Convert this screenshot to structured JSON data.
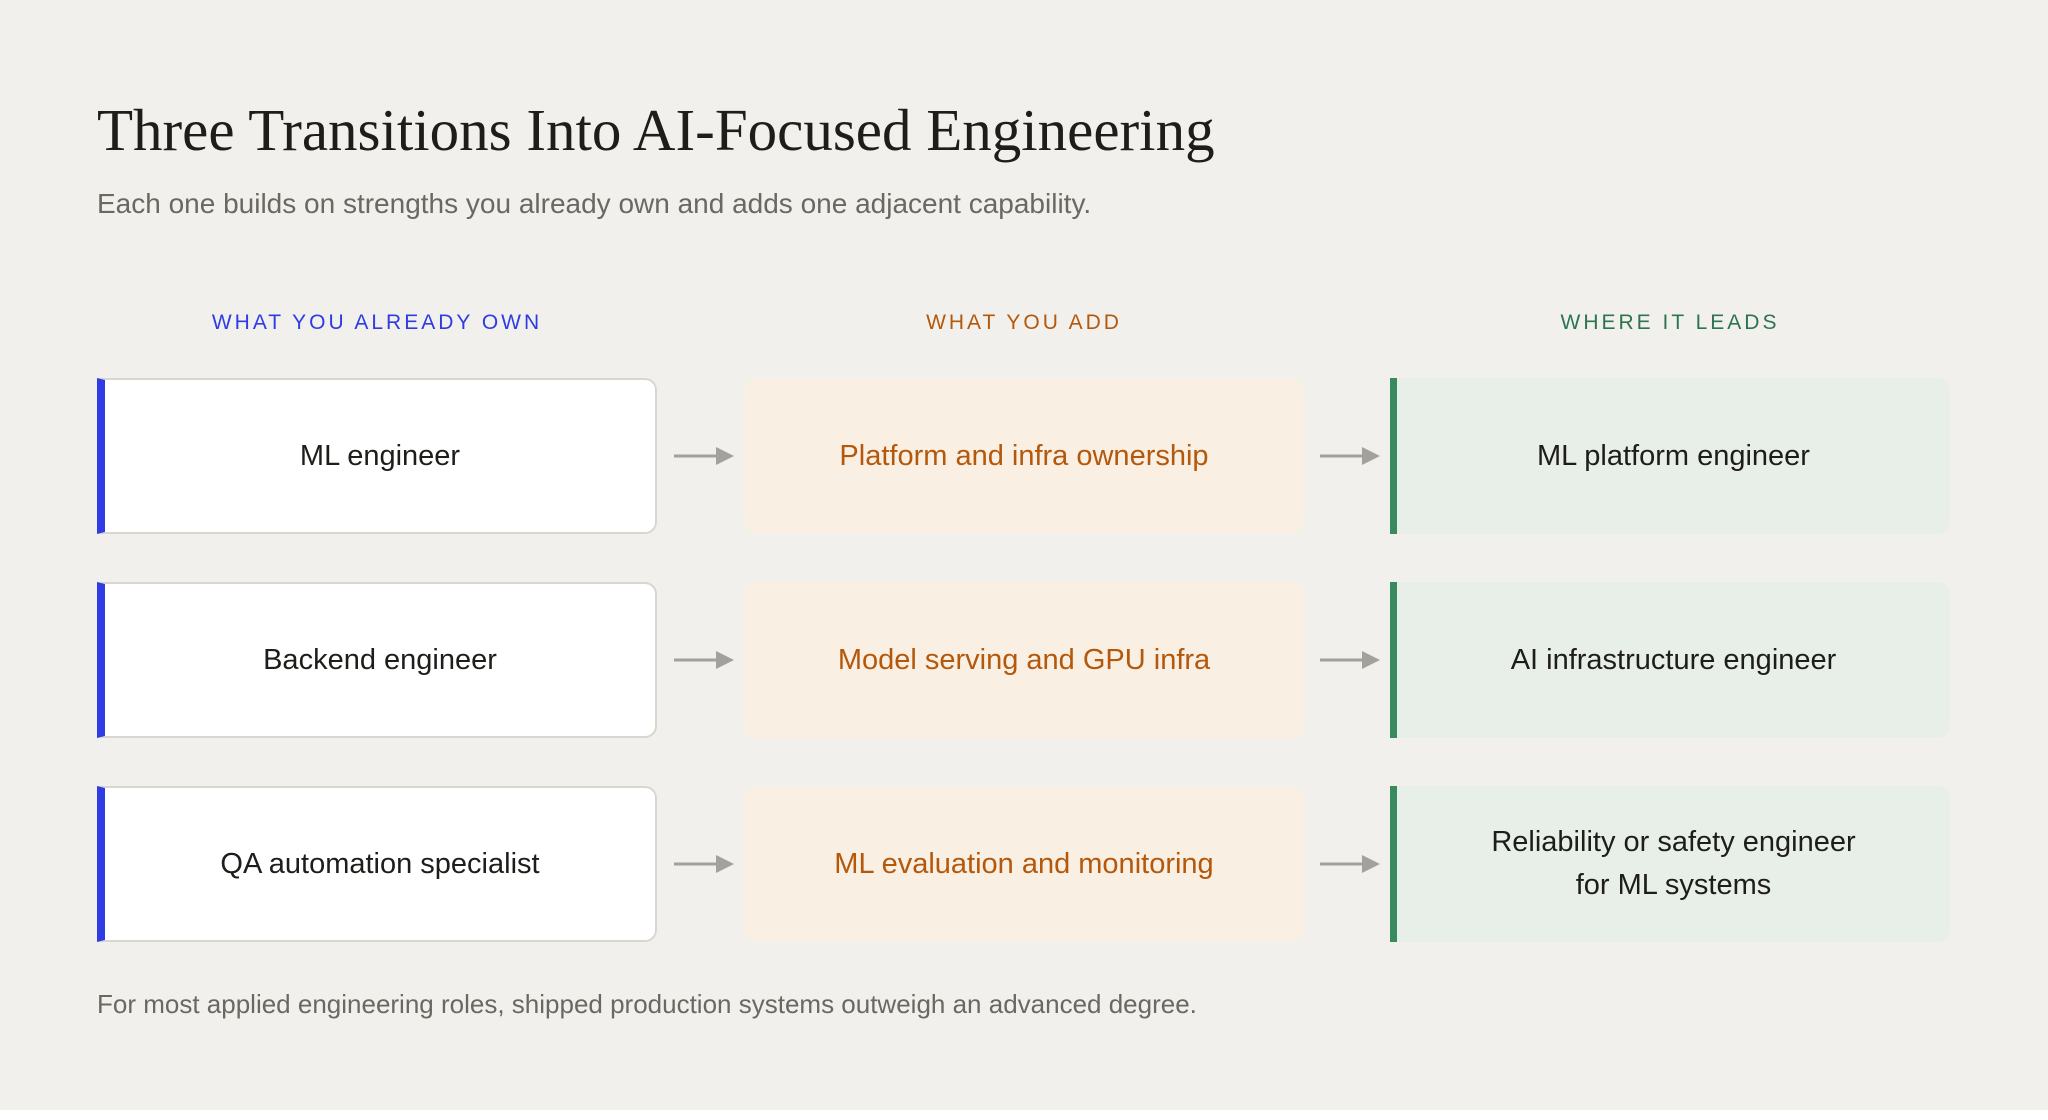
{
  "title": "Three Transitions Into AI-Focused Engineering",
  "subtitle": "Each one builds on strengths you already own and adds one adjacent capability.",
  "columns": {
    "own": "WHAT YOU ALREADY OWN",
    "add": "WHAT YOU ADD",
    "leads": "WHERE IT LEADS"
  },
  "rows": [
    {
      "own": "ML engineer",
      "add": "Platform and infra ownership",
      "leads": [
        "ML platform engineer"
      ]
    },
    {
      "own": "Backend engineer",
      "add": "Model serving and GPU infra",
      "leads": [
        "AI infrastructure engineer"
      ]
    },
    {
      "own": "QA automation specialist",
      "add": "ML evaluation and monitoring",
      "leads": [
        "Reliability or safety engineer",
        "for ML systems"
      ]
    }
  ],
  "footnote": "For most applied engineering roles, shipped production systems outweigh an advanced degree.",
  "colors": {
    "own_accent": "#2f3be3",
    "add_accent": "#b4580c",
    "leads_accent": "#3a8a5f",
    "arrow": "#a3a19c",
    "background": "#f2f0ec"
  },
  "icons": {
    "connector": "arrow-right-icon"
  }
}
